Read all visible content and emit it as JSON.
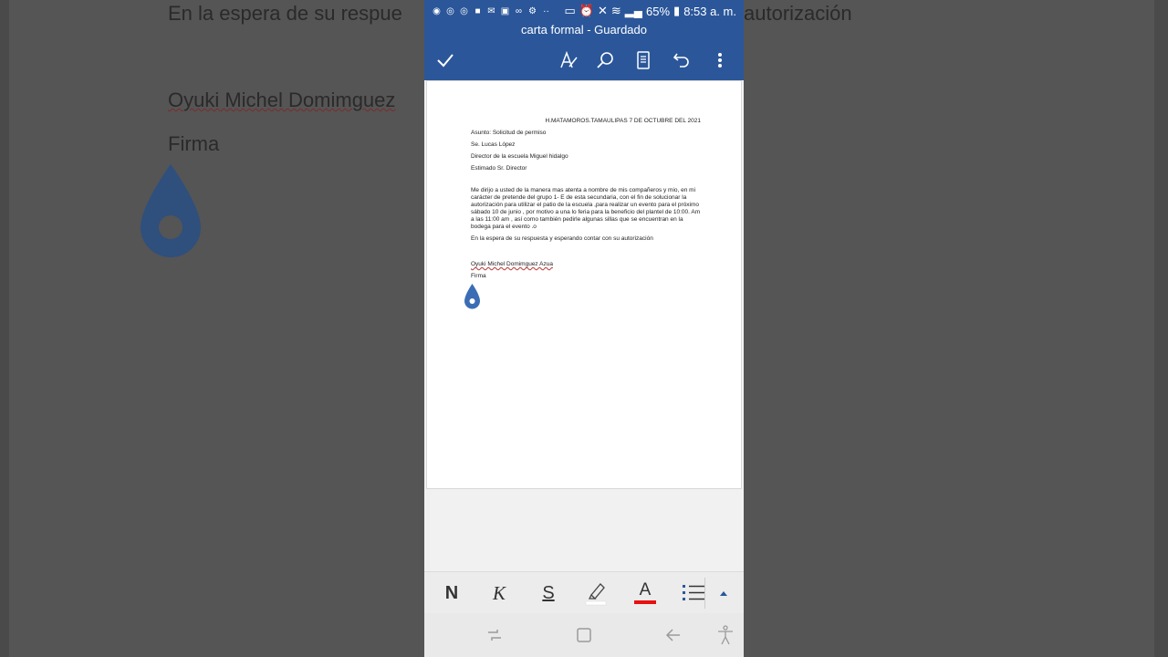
{
  "status": {
    "battery": "65%",
    "time": "8:53 a. m."
  },
  "app": {
    "title": "carta formal - Guardado"
  },
  "doc": {
    "date": "H.MATAMOROS.TAMAULIPAS 7 DE OCTUBRE DEL 2021",
    "subject": "Asunto: Solicitud de permiso",
    "recipient": "Se. Lucas López",
    "role": "Director de la escuela Miguel hidalgo",
    "greeting": "Estimado Sr. Director",
    "body": "Me dirijo a usted de la manera mas atenta a nombre de mis compañeros y mio, en mi carácter de pretende del grupo 1- E de esta secundaria, con el fin de solucionar la autorización para utilizar el patio de la escuela ,para realizar un evento para el próximo sábado 10 de junio , por motivo a una lo feria para la beneficio del plantel de 10:00.  Am a las 11:00 am , así como también pedirle algunas sillas que se encuentran en la bodega para el evento .o",
    "closing": "En la espera de su respuesta y esperando contar con su autorización",
    "signer": "Oyuki Michel Domimguez Azua",
    "signature": "Firma"
  },
  "background": {
    "line1_left": "En la espera de su respue",
    "line1_right": "autorización",
    "signer": "Oyuki Michel Domimguez",
    "signature": "Firma"
  },
  "format": {
    "bold": "N",
    "italic": "K",
    "underline": "S",
    "font_color": "A"
  },
  "colors": {
    "appbar": "#2b579a",
    "font_color_swatch": "#e81010",
    "highlight_swatch": "#ffffff",
    "accent_drop": "#3b6db4"
  }
}
